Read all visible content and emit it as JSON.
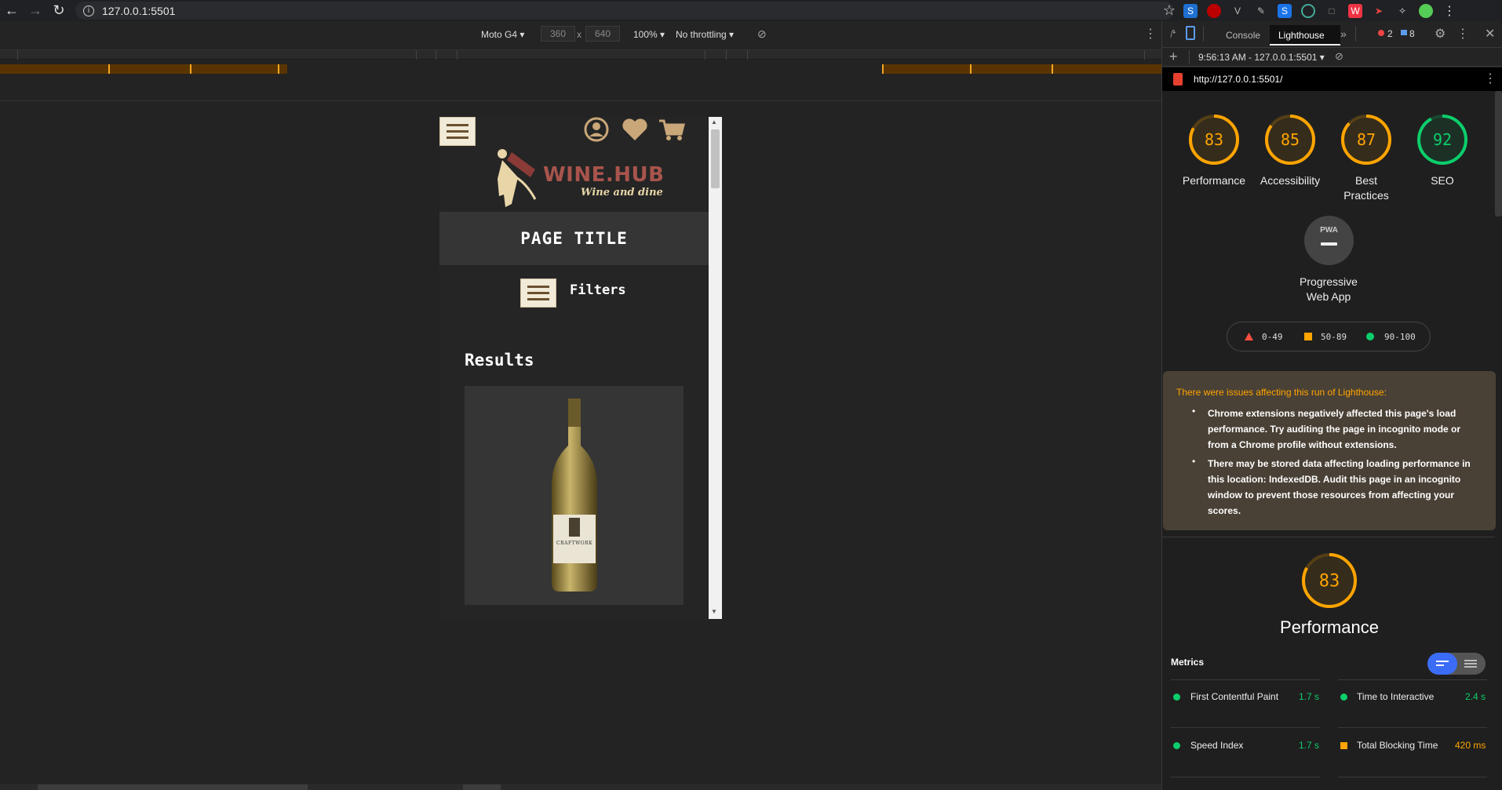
{
  "browser": {
    "url": "127.0.0.1:5501",
    "colors": {
      "tick": "#f5a623",
      "pass": "#0cce6b",
      "average": "#ffa400",
      "fail": "#ff4e42"
    }
  },
  "device_toolbar": {
    "device": "Moto G4",
    "width": "360",
    "x": "x",
    "height": "640",
    "zoom": "100%",
    "throttling": "No throttling"
  },
  "site": {
    "brand_name": "WINE.HUB",
    "tagline": "Wine and dine",
    "page_title": "PAGE TITLE",
    "filters_label": "Filters",
    "results_heading": "Results",
    "product_label": "CRAFTWORK"
  },
  "devtools": {
    "tab_console": "Console",
    "tab_lighthouse": "Lighthouse",
    "errors": "2",
    "messages": "8",
    "report_time": "9:56:13 AM - 127.0.0.1:5501",
    "report_url": "http://127.0.0.1:5501/"
  },
  "lighthouse": {
    "gauges": [
      {
        "score": 83,
        "label_1": "Performance",
        "label_2": "",
        "color": "#ffa400"
      },
      {
        "score": 85,
        "label_1": "Accessibility",
        "label_2": "",
        "color": "#ffa400"
      },
      {
        "score": 87,
        "label_1": "Best",
        "label_2": "Practices",
        "color": "#ffa400"
      },
      {
        "score": 92,
        "label_1": "SEO",
        "label_2": "",
        "color": "#0cce6b"
      }
    ],
    "pwa_badge": "PWA",
    "pwa_label_1": "Progressive",
    "pwa_label_2": "Web App",
    "legend": {
      "fail": "0-49",
      "average": "50-89",
      "pass": "90-100"
    },
    "warning_title": "There were issues affecting this run of Lighthouse:",
    "warnings": [
      "Chrome extensions negatively affected this page's load performance. Try auditing the page in incognito mode or from a Chrome profile without extensions.",
      "There may be stored data affecting loading performance in this location: IndexedDB. Audit this page in an incognito window to prevent those resources from affecting your scores."
    ],
    "perf_score": 83,
    "perf_title": "Performance",
    "metrics_heading": "Metrics",
    "metrics": {
      "fcp_label": "First Contentful Paint",
      "fcp_value": "1.7 s",
      "tti_label": "Time to Interactive",
      "tti_value": "2.4 s",
      "si_label": "Speed Index",
      "si_value": "1.7 s",
      "tbt_label": "Total Blocking Time",
      "tbt_value": "420 ms"
    }
  }
}
